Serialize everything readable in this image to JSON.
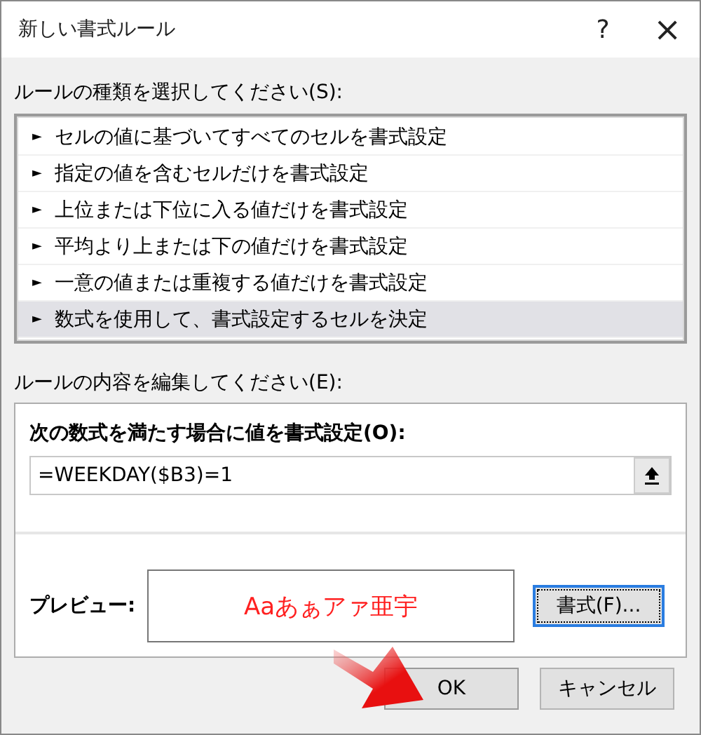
{
  "window": {
    "title": "新しい書式ルール",
    "help": "?",
    "close": "×"
  },
  "rule_type": {
    "label": "ルールの種類を選択してください(S):",
    "items": [
      {
        "bullet": "►",
        "text": "セルの値に基づいてすべてのセルを書式設定",
        "selected": false
      },
      {
        "bullet": "►",
        "text": "指定の値を含むセルだけを書式設定",
        "selected": false
      },
      {
        "bullet": "►",
        "text": "上位または下位に入る値だけを書式設定",
        "selected": false
      },
      {
        "bullet": "►",
        "text": "平均より上または下の値だけを書式設定",
        "selected": false
      },
      {
        "bullet": "►",
        "text": "一意の値または重複する値だけを書式設定",
        "selected": false
      },
      {
        "bullet": "►",
        "text": "数式を使用して、書式設定するセルを決定",
        "selected": true
      }
    ]
  },
  "rule_edit": {
    "label": "ルールの内容を編集してください(E):",
    "formula_label": "次の数式を満たす場合に値を書式設定(O):",
    "formula": "=WEEKDAY($B3)=1",
    "preview_label": "プレビュー:",
    "preview_text": "Aaあぁアァ亜宇",
    "format_button": "書式(F)..."
  },
  "buttons": [
    {
      "label": "OK",
      "kind": "ok"
    },
    {
      "label": "キャンセル",
      "kind": "cancel"
    }
  ]
}
